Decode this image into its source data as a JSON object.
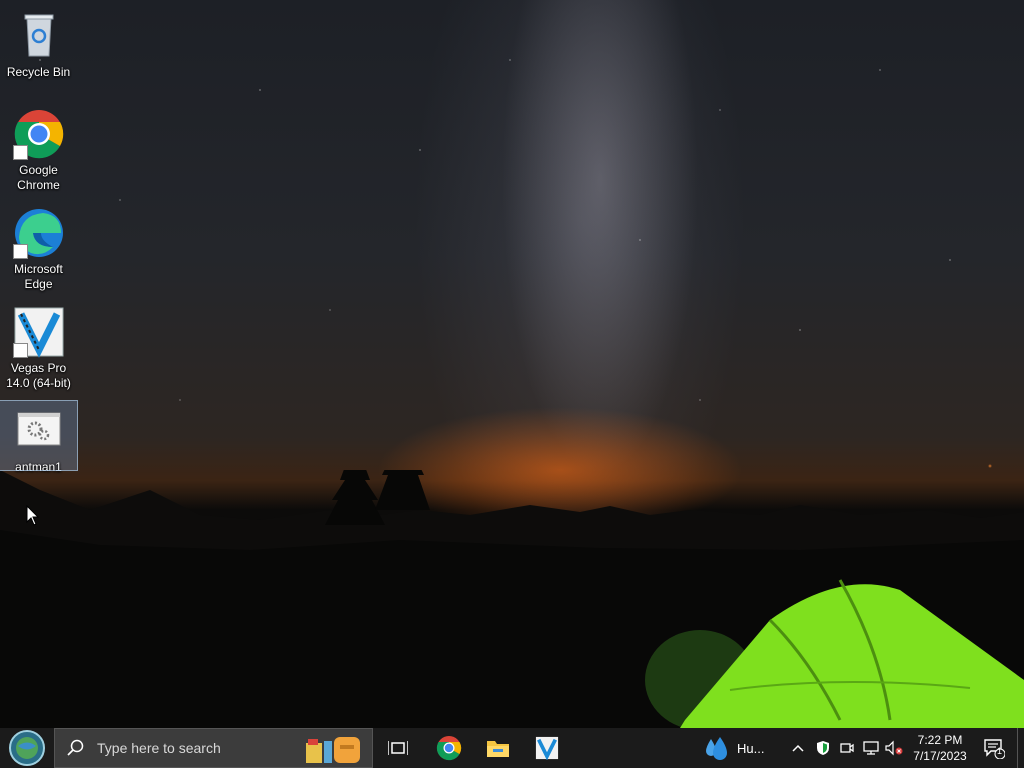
{
  "desktop": {
    "icons": [
      {
        "label": "Recycle Bin",
        "icon": "recycle-bin-icon"
      },
      {
        "label": "Google Chrome",
        "icon": "chrome-icon"
      },
      {
        "label": "Microsoft Edge",
        "icon": "edge-icon"
      },
      {
        "label": "Vegas Pro 14.0 (64-bit)",
        "icon": "vegas-pro-icon"
      },
      {
        "label": "antman1",
        "icon": "settings-file-icon",
        "selected": true
      }
    ]
  },
  "taskbar": {
    "search_placeholder": "Type here to search",
    "weather_text": "Hu...",
    "clock": {
      "time": "7:22 PM",
      "date": "7/17/2023"
    },
    "notification_count": "1",
    "pinned": [
      "chrome-icon",
      "file-explorer-icon",
      "vegas-pro-icon"
    ]
  }
}
